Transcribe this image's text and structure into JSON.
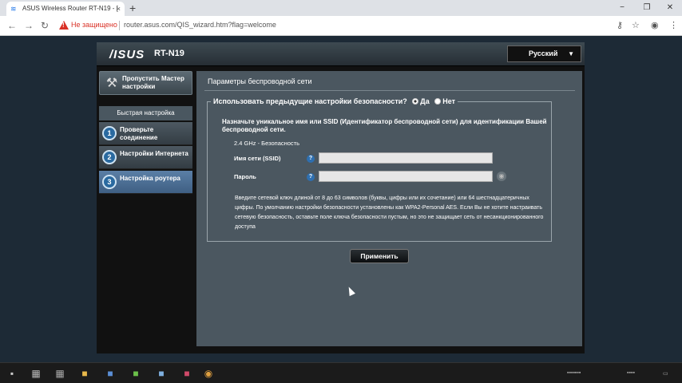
{
  "browser": {
    "tab_title": "ASUS Wireless Router RT-N19 - [",
    "tab_close": "×",
    "new_tab": "+",
    "window_controls": {
      "minimize": "−",
      "maximize": "❐",
      "close": "✕"
    },
    "nav": {
      "back": "←",
      "forward": "→",
      "reload": "↻"
    },
    "security_label": "Не защищено",
    "url": "router.asus.com/QIS_wizard.htm?flag=welcome",
    "toolbar_icons": {
      "key": "⚷",
      "star": "☆",
      "profile": "◉",
      "menu": "⋮"
    }
  },
  "router": {
    "logo": "/ISUS",
    "model": "RT-N19",
    "language": {
      "selected": "Русский",
      "arrow": "▼"
    },
    "skip_wizard": {
      "label": "Пропустить Мастер настройки",
      "icon": "wrench-icon",
      "glyph": "⚒"
    },
    "quick_setup_title": "Быстрая настройка",
    "steps": [
      {
        "num": "1",
        "label": "Проверьте соединение",
        "active": false
      },
      {
        "num": "2",
        "label": "Настройки Интернета",
        "active": false
      },
      {
        "num": "3",
        "label": "Настройка роутера",
        "active": true
      }
    ],
    "content": {
      "title": "Параметры беспроводной сети",
      "legend_question": "Использовать предыдущие настройки безопасности?",
      "option_yes": "Да",
      "option_no": "Нет",
      "intro": "Назначьте уникальное имя или SSID (Идентификатор беспроводной сети) для идентификации Вашей беспроводной сети.",
      "band": "2.4 GHz - Безопасность",
      "ssid": {
        "label": "Имя сети (SSID)",
        "help": "?",
        "value": ""
      },
      "password": {
        "label": "Пароль",
        "help": "?",
        "value": ""
      },
      "eye_glyph": "◉",
      "description": "Введите сетевой ключ длиной от 8 до 63 символов (буквы, цифры или их сочетание) или 64 шестнадцатеричных цифры. По умолчанию настройки безопасности установлены как WPA2-Personal AES. Если Вы не хотите настраивать сетевую безопасность, оставьте поле ключа безопасности пустым, но это не защищает сеть от несанкционированного доступа",
      "apply": "Применить"
    }
  },
  "taskbar": {
    "icons": [
      {
        "name": "start-icon",
        "glyph": "▪",
        "color": "#cccccc"
      },
      {
        "name": "taskview-icon",
        "glyph": "▦",
        "color": "#bbbbbb"
      },
      {
        "name": "app-icon-1",
        "glyph": "▦",
        "color": "#aaaaaa"
      },
      {
        "name": "folder-icon",
        "glyph": "■",
        "color": "#e8b84a"
      },
      {
        "name": "app-icon-2",
        "glyph": "■",
        "color": "#5b8fd6"
      },
      {
        "name": "app-icon-3",
        "glyph": "■",
        "color": "#6cc04a"
      },
      {
        "name": "app-icon-4",
        "glyph": "■",
        "color": "#7fb0e0"
      },
      {
        "name": "app-icon-5",
        "glyph": "■",
        "color": "#d04a6a"
      },
      {
        "name": "chrome-icon",
        "glyph": "◉",
        "color": "#e0a040"
      }
    ]
  }
}
